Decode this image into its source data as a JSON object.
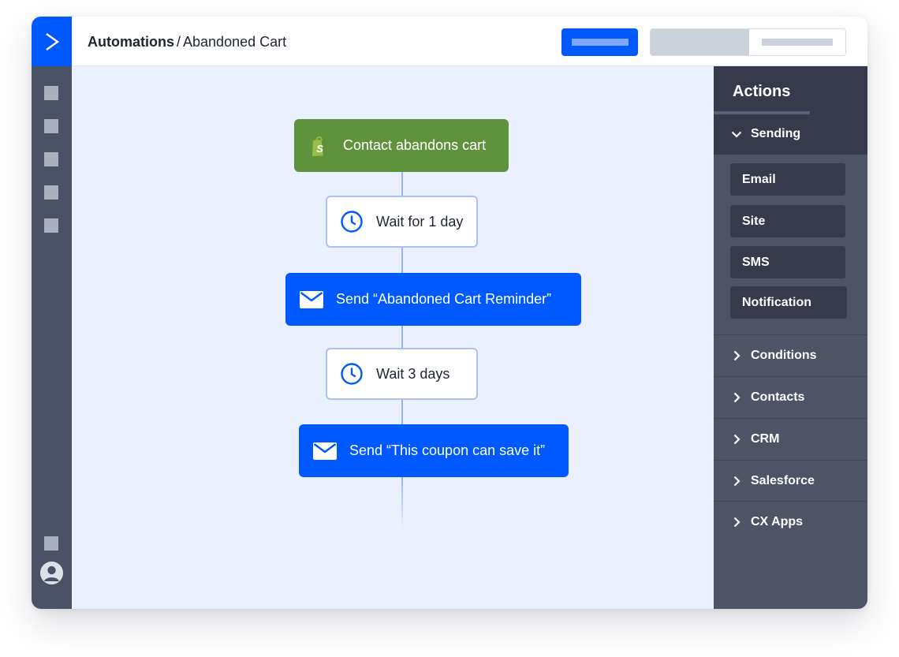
{
  "header": {
    "breadcrumb_section": "Automations",
    "breadcrumb_separator": "/",
    "breadcrumb_page": "Abandoned Cart"
  },
  "workflow": {
    "trigger": {
      "label": "Contact abandons cart",
      "icon": "shopify-bag-icon"
    },
    "steps": [
      {
        "type": "wait",
        "label": "Wait for 1 day",
        "icon": "clock-icon"
      },
      {
        "type": "send",
        "label": "Send “Abandoned Cart Reminder”",
        "icon": "envelope-icon"
      },
      {
        "type": "wait",
        "label": "Wait 3 days",
        "icon": "clock-icon"
      },
      {
        "type": "send",
        "label": "Send “This coupon can save it”",
        "icon": "envelope-icon"
      }
    ]
  },
  "panel": {
    "title": "Actions",
    "sending": {
      "label": "Sending",
      "expanded": true,
      "items": [
        "Email",
        "Site",
        "SMS",
        "Notification"
      ]
    },
    "collapsed_sections": [
      "Conditions",
      "Contacts",
      "CRM",
      "Salesforce",
      "CX Apps"
    ]
  },
  "colors": {
    "brand_blue": "#0058ff",
    "trigger_green": "#5f923d",
    "canvas_bg": "#eaf0fd",
    "rail_bg": "#4c5266",
    "panel_bg": "#4e5366",
    "panel_dark": "#363a4b"
  }
}
